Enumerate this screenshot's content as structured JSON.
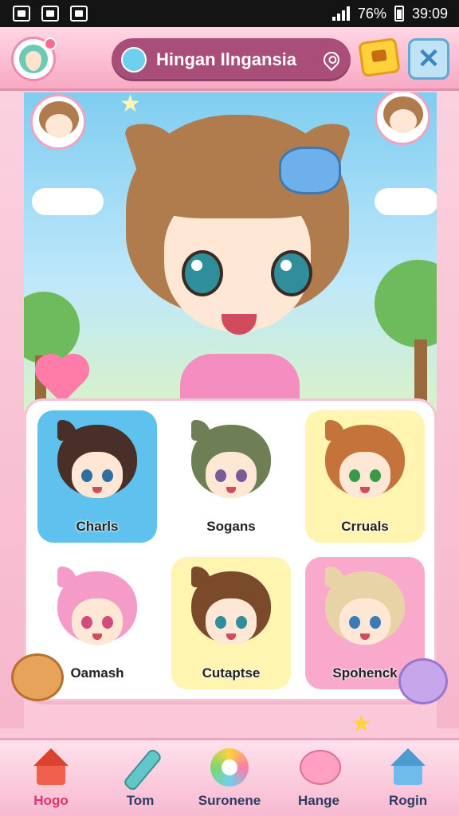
{
  "status_bar": {
    "battery_percent": "76%",
    "time": "39:09"
  },
  "header": {
    "title": "Hingan Ilngansia"
  },
  "characters": [
    {
      "label": "Charls",
      "tile_color": "#5fc1ee",
      "hair_color": "#4a2f28",
      "eye_color": "#2f6ea0"
    },
    {
      "label": "Sogans",
      "tile_color": "#ffffff",
      "hair_color": "#6f7f55",
      "eye_color": "#7a5b9a"
    },
    {
      "label": "Crruals",
      "tile_color": "#fff4b0",
      "hair_color": "#c4743a",
      "eye_color": "#3a9a4a"
    },
    {
      "label": "Oamash",
      "tile_color": "#ffffff",
      "hair_color": "#f59bc8",
      "eye_color": "#d24b7a"
    },
    {
      "label": "Cutaptse",
      "tile_color": "#fff4b0",
      "hair_color": "#7a4a2a",
      "eye_color": "#2f8e9a"
    },
    {
      "label": "Spohenck",
      "tile_color": "#f9a9cc",
      "hair_color": "#e7d3a6",
      "eye_color": "#3a7ab5"
    }
  ],
  "bottom_nav": [
    {
      "label": "Hogo",
      "icon": "home-icon",
      "active": true
    },
    {
      "label": "Tom",
      "icon": "pen-icon",
      "active": false
    },
    {
      "label": "Suronene",
      "icon": "color-ring-icon",
      "active": false
    },
    {
      "label": "Hange",
      "icon": "chat-bubble-icon",
      "active": false
    },
    {
      "label": "Rogin",
      "icon": "house-icon",
      "active": false
    }
  ],
  "colors": {
    "accent_pink": "#f7a9c3",
    "title_pill": "#a94d79",
    "active_nav": "#e0336a"
  }
}
